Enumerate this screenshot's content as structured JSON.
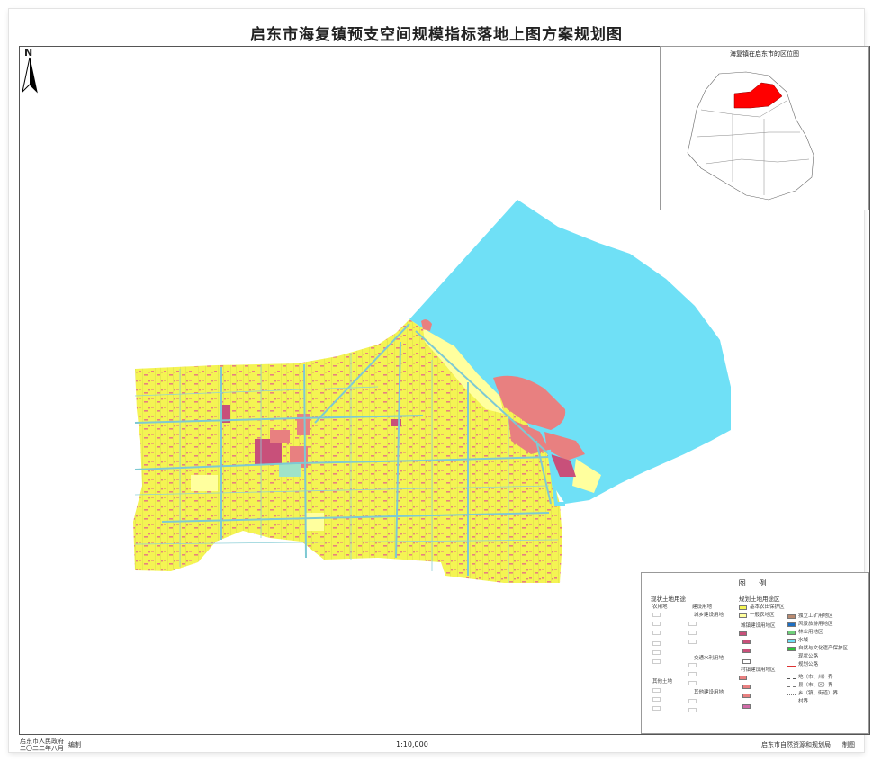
{
  "title": "启东市海复镇预支空间规模指标落地上图方案规划图",
  "north": "N",
  "inset": {
    "title": "海复镇在启东市的区位图"
  },
  "legend": {
    "title": "图 例",
    "left_heading": "现状土地用途",
    "right_heading": "规划土地用途区",
    "agri_heading": "农用地",
    "build_heading": "建设用地",
    "other_heading": "其他土地",
    "town_heading": "城乡建设用地",
    "traffic_heading": "交通水利用地",
    "other_build_heading": "其他建设用地",
    "town_zone_heading": "城镇建设用地区",
    "village_zone_heading": "村镇建设用地区",
    "yellow1": "基本农田保护区",
    "yellow2": "一般农地区",
    "mining": "独立工矿用地区",
    "scenic": "风景旅游用地区",
    "ecology": "林业用地区",
    "water": "水域",
    "nature": "自然与文化遗产保护区",
    "road_now": "现状公路",
    "road_plan": "规划公路",
    "b1": "地（市、州）界",
    "b2": "县（市、区）界",
    "b3": "乡（镇、街道）界",
    "b4": "村界"
  },
  "footer": {
    "gov": "启东市人民政府",
    "date": "二〇二二年八月",
    "compile": "编制",
    "scale": "1:10,000",
    "bureau": "启东市自然资源和规划局",
    "draw": "制图"
  },
  "colors": {
    "farmland": "#f4f453",
    "general": "#ffff9e",
    "settlement": "#e88080",
    "town": "#c8507a",
    "water": "#6fe0f6",
    "road": "#7ec9d3",
    "highlight": "#ff0000"
  }
}
